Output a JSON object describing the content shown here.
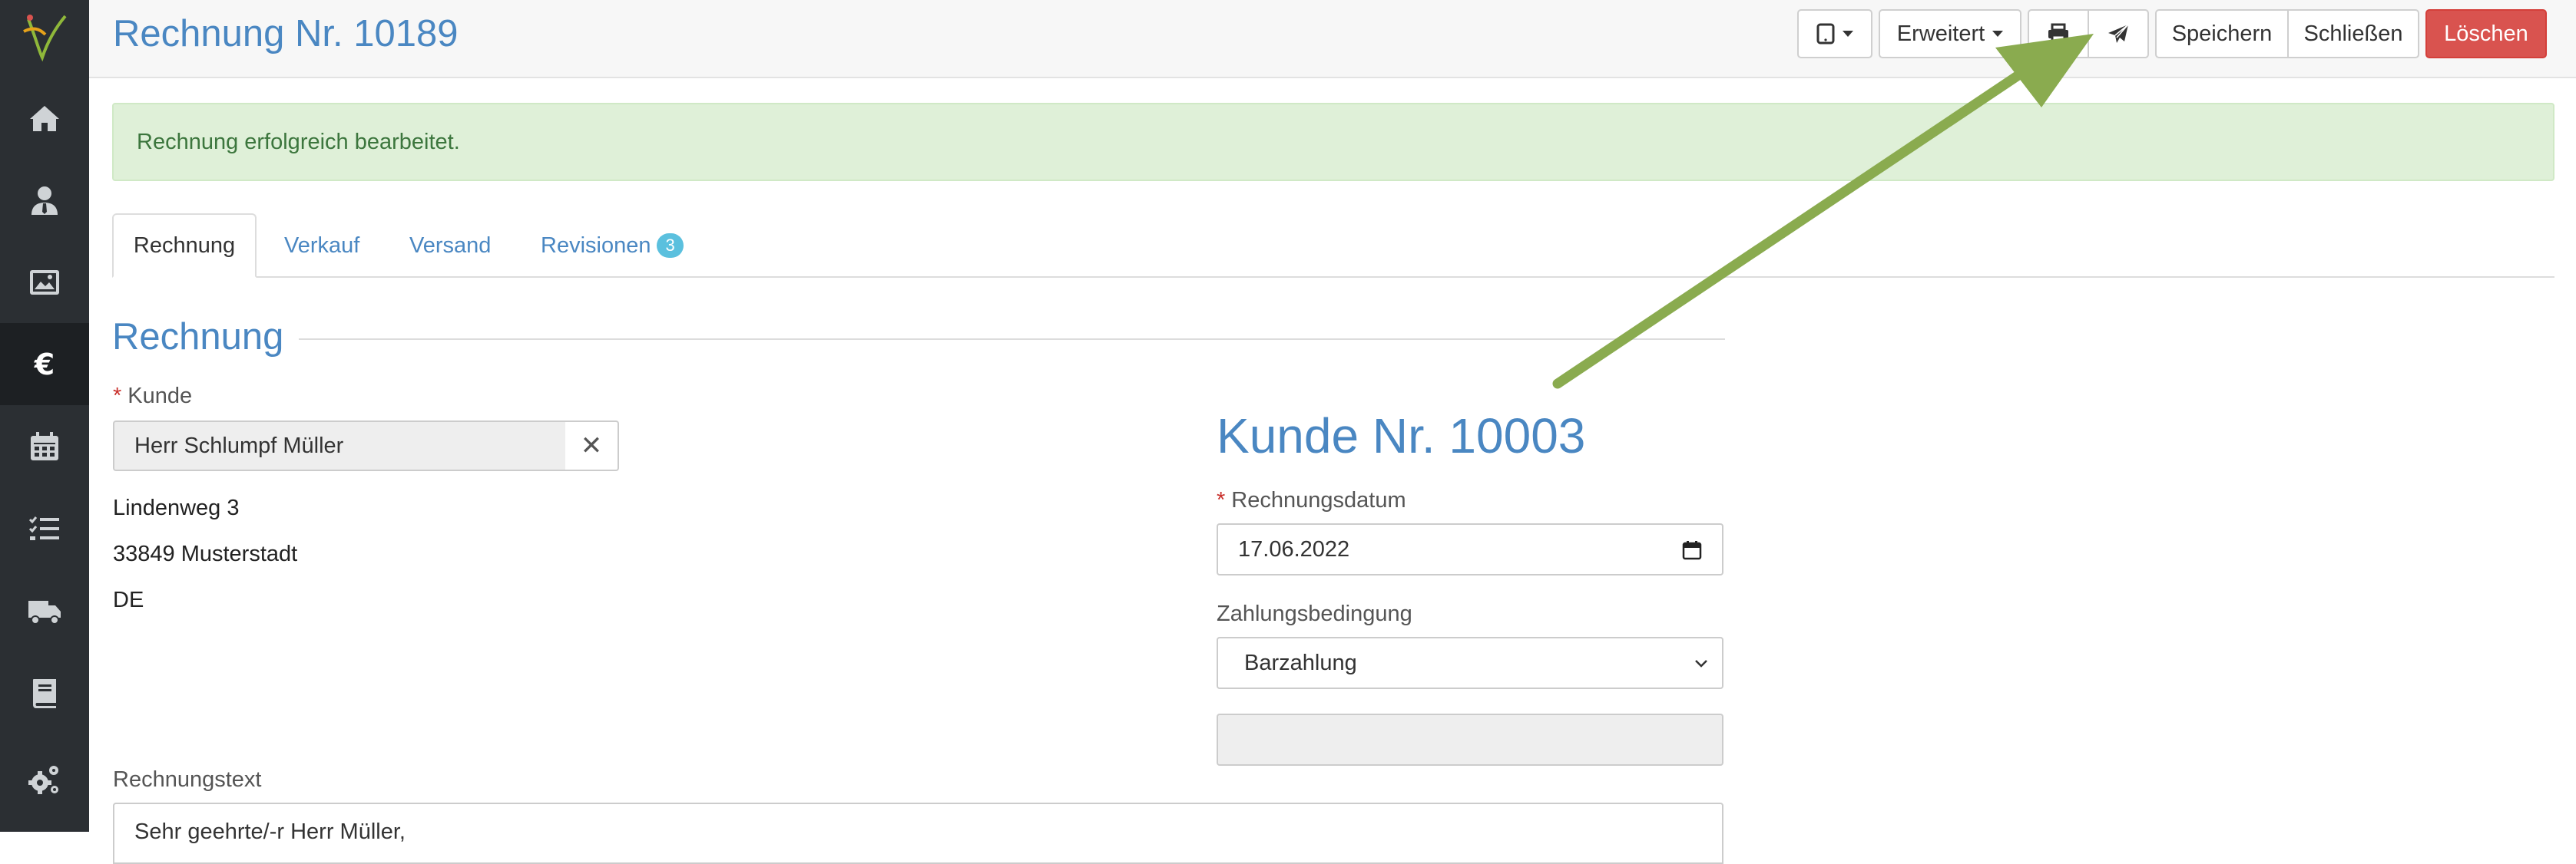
{
  "header": {
    "title": "Rechnung Nr. 10189",
    "toolbar": {
      "extended_label": "Erweitert",
      "save_label": "Speichern",
      "close_label": "Schließen",
      "delete_label": "Löschen"
    }
  },
  "alert": {
    "message": "Rechnung erfolgreich bearbeitet."
  },
  "tabs": [
    {
      "label": "Rechnung"
    },
    {
      "label": "Verkauf"
    },
    {
      "label": "Versand"
    },
    {
      "label": "Revisionen",
      "badge": "3"
    }
  ],
  "section": {
    "title": "Rechnung"
  },
  "customer": {
    "label": "Kunde",
    "value": "Herr Schlumpf Müller",
    "address": [
      "Lindenweg 3",
      "33849 Musterstadt",
      "DE"
    ],
    "number_title": "Kunde Nr. 10003"
  },
  "invoice_date": {
    "label": "Rechnungsdatum",
    "value": "17.06.2022"
  },
  "payment": {
    "label": "Zahlungsbedingung",
    "value": "Barzahlung"
  },
  "invoice_text": {
    "label": "Rechnungstext",
    "value": "Sehr geehrte/-r Herr Müller,"
  },
  "colors": {
    "brand_blue": "#4a87c2",
    "sidebar": "#2b2f33",
    "danger": "#d9534f",
    "success_bg": "#dff0d8",
    "annotation_arrow": "#8aab4f"
  },
  "icons": {
    "sidebar": [
      "home-icon",
      "user-tie-icon",
      "image-icon",
      "euro-icon",
      "calendar-icon",
      "task-list-icon",
      "truck-icon",
      "book-icon",
      "cogs-icon"
    ],
    "toolbar": [
      "tablet-icon",
      "print-icon",
      "send-icon"
    ]
  }
}
